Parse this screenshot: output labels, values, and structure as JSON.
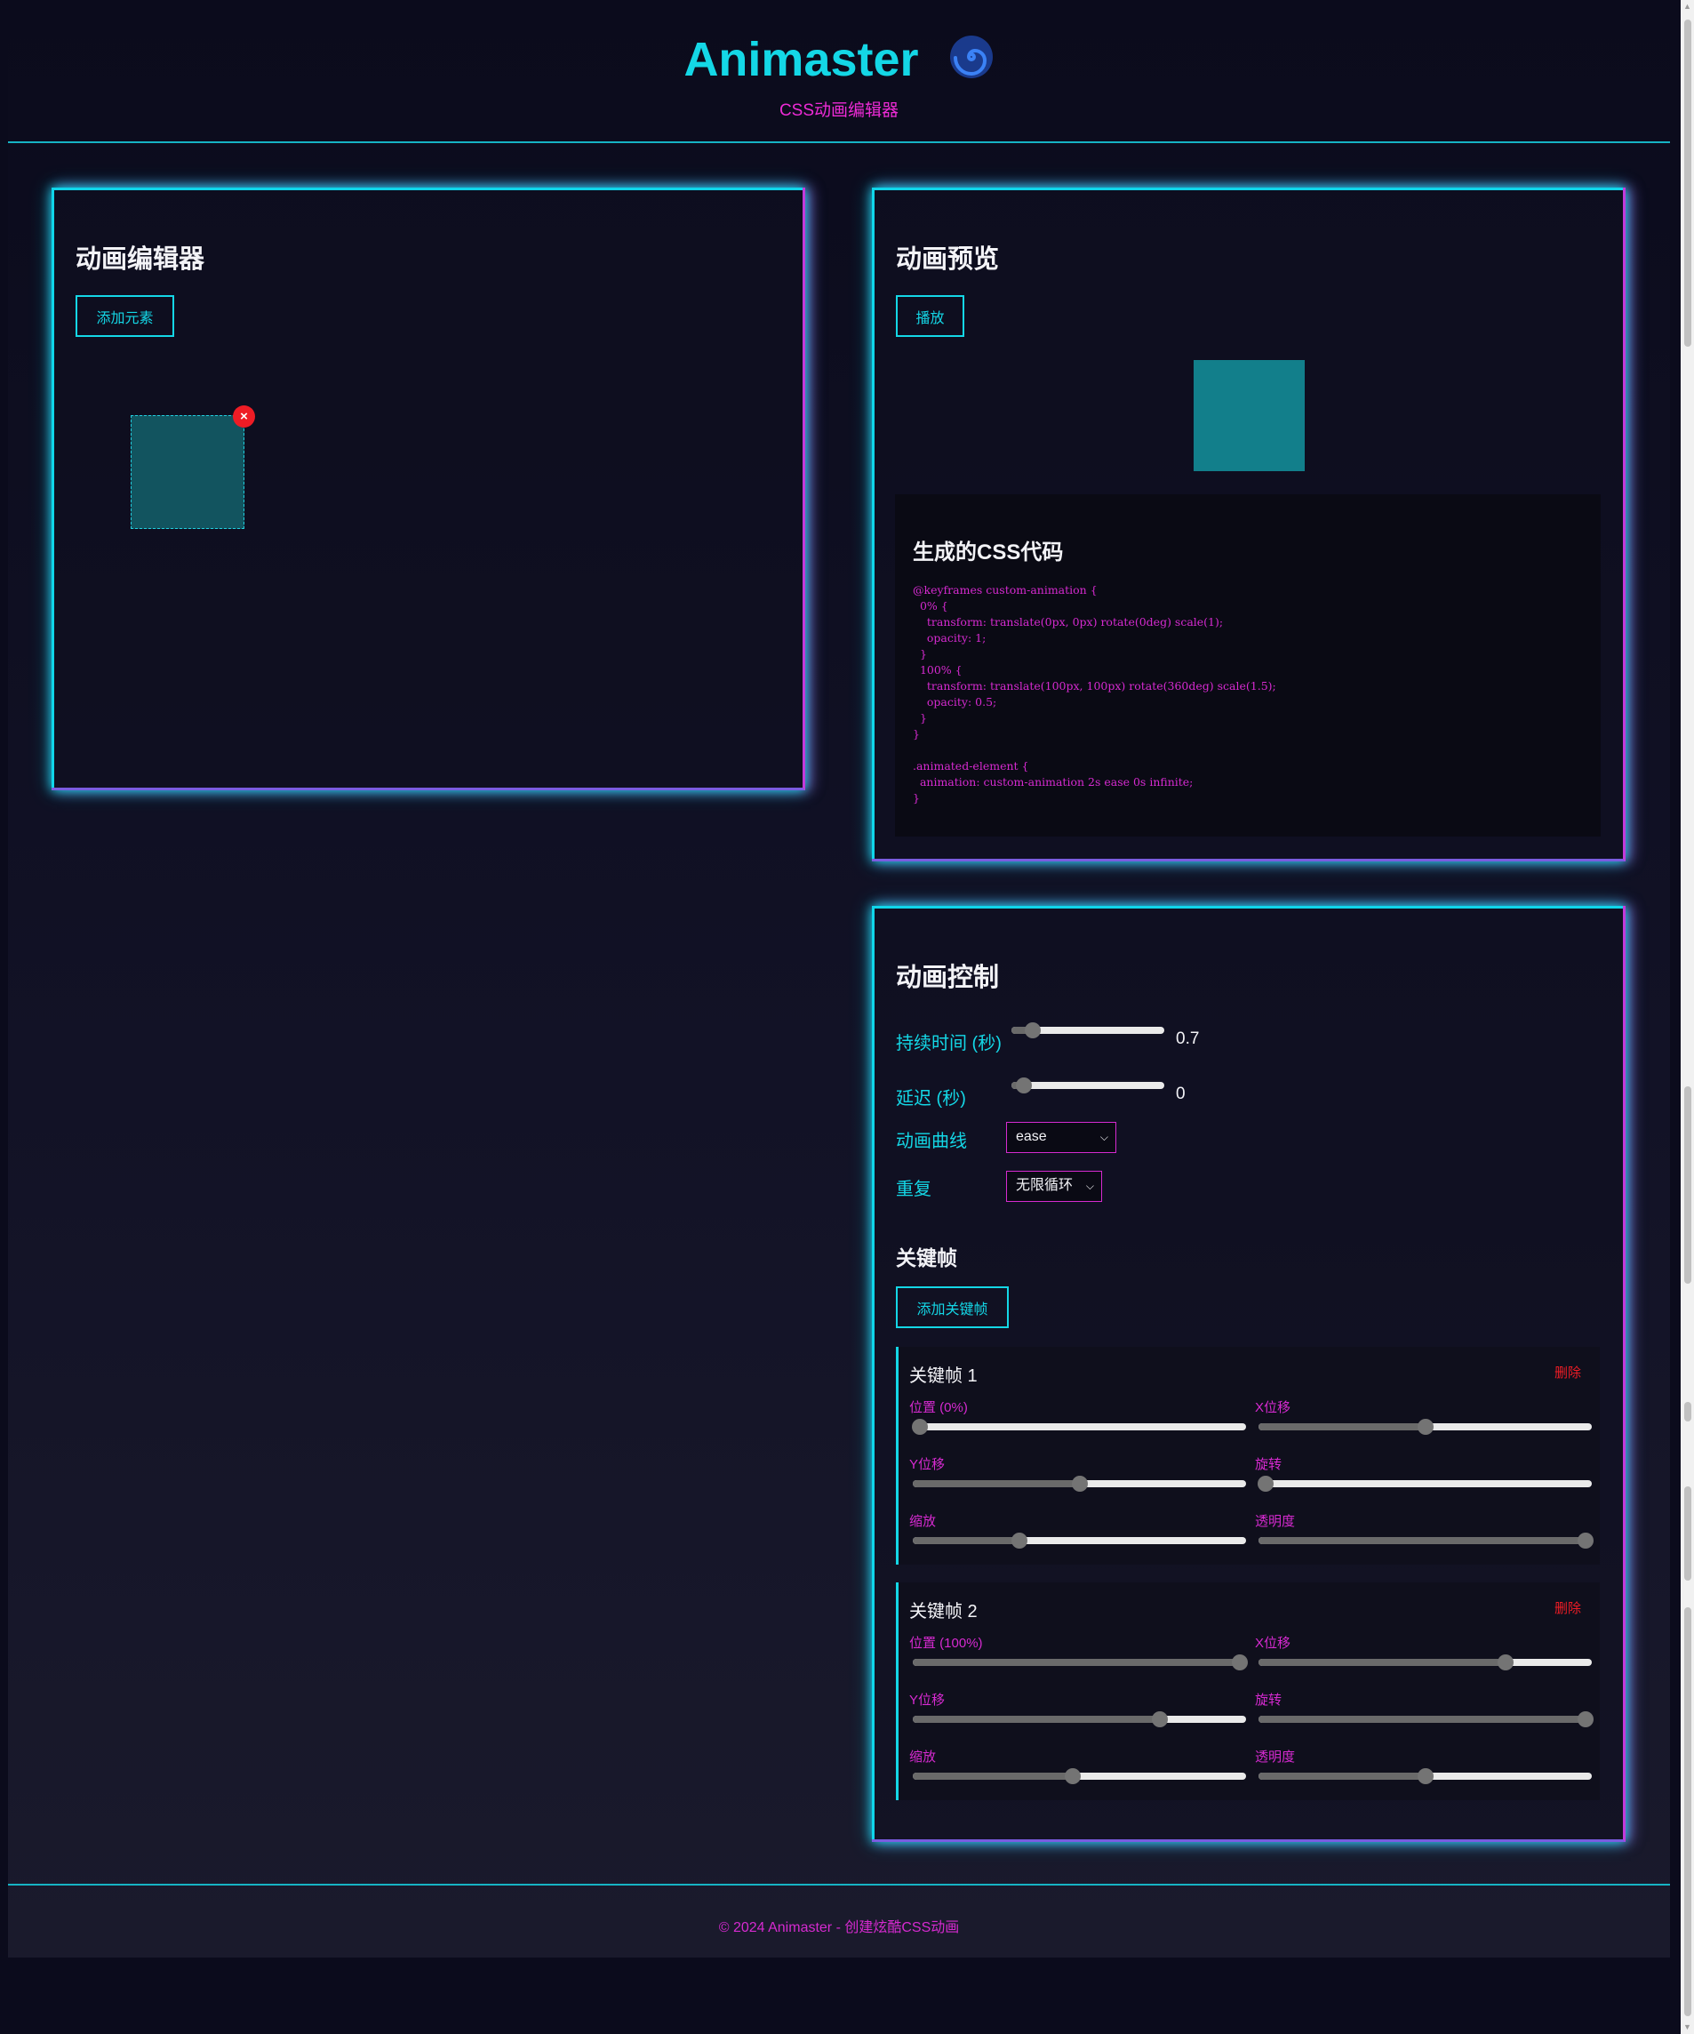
{
  "header": {
    "title": "Animaster",
    "subtitle": "CSS动画编辑器"
  },
  "editor": {
    "title": "动画编辑器",
    "add_button": "添加元素",
    "delete_badge": "×"
  },
  "preview": {
    "title": "动画预览",
    "play_button": "播放",
    "code_title": "生成的CSS代码",
    "code": "@keyframes custom-animation {\n  0% {\n    transform: translate(0px, 0px) rotate(0deg) scale(1);\n    opacity: 1;\n  }\n  100% {\n    transform: translate(100px, 100px) rotate(360deg) scale(1.5);\n    opacity: 0.5;\n  }\n}\n\n.animated-element {\n  animation: custom-animation 2s ease 0s infinite;\n}"
  },
  "controls": {
    "title": "动画控制",
    "duration_label": "持续时间 (秒)",
    "duration_value": "0.7",
    "duration_fraction": 0.14,
    "delay_label": "延迟 (秒)",
    "delay_value": "0",
    "delay_fraction": 0.08,
    "easing_label": "动画曲线",
    "easing_value": "ease",
    "repeat_label": "重复",
    "repeat_value": "无限循环",
    "keyframes_title": "关键帧",
    "add_keyframe_button": "添加关键帧"
  },
  "keyframes": [
    {
      "title": "关键帧 1",
      "delete_label": "删除",
      "fields": [
        {
          "label": "位置 (0%)",
          "fraction": 0.02
        },
        {
          "label": "X位移",
          "fraction": 0.5
        },
        {
          "label": "Y位移",
          "fraction": 0.5
        },
        {
          "label": "旋转",
          "fraction": 0.02
        },
        {
          "label": "缩放",
          "fraction": 0.32
        },
        {
          "label": "透明度",
          "fraction": 0.98
        }
      ]
    },
    {
      "title": "关键帧 2",
      "delete_label": "删除",
      "fields": [
        {
          "label": "位置 (100%)",
          "fraction": 0.98
        },
        {
          "label": "X位移",
          "fraction": 0.74
        },
        {
          "label": "Y位移",
          "fraction": 0.74
        },
        {
          "label": "旋转",
          "fraction": 0.98
        },
        {
          "label": "缩放",
          "fraction": 0.48
        },
        {
          "label": "透明度",
          "fraction": 0.5
        }
      ]
    }
  ],
  "footer": {
    "text": "© 2024 Animaster - 创建炫酷CSS动画"
  },
  "colors": {
    "accent_cyan": "#14d7e6",
    "accent_magenta": "#d62ad0",
    "danger": "#ee1c25",
    "background": "#0b0b1c"
  }
}
